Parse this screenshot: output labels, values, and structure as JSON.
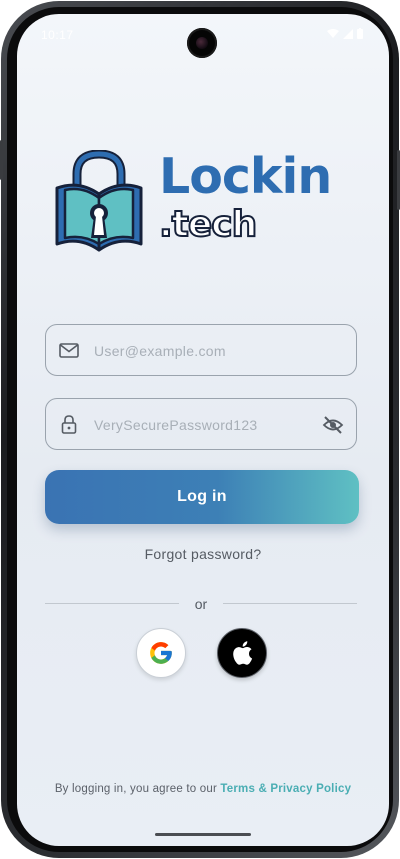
{
  "status_bar": {
    "time": "10:17",
    "left_icons": [
      "notification-icon",
      "sim-icon"
    ],
    "right_icons": [
      "wifi-icon",
      "signal-icon",
      "battery-icon"
    ]
  },
  "logo": {
    "brand": "Lockin",
    "domain": ".tech",
    "colors": {
      "blue": "#2e6db1",
      "teal": "#5fc0c3",
      "outline": "#16213a"
    }
  },
  "form": {
    "email": {
      "value": "",
      "placeholder": "User@example.com",
      "icon": "mail-icon"
    },
    "password": {
      "value": "",
      "placeholder": "VerySecurePassword123",
      "icon": "lock-icon",
      "toggle_icon": "eye-off-icon"
    },
    "login_label": "Log in",
    "forgot_label": "Forgot password?",
    "divider_label": "or"
  },
  "social": {
    "google_icon": "google-icon",
    "apple_icon": "apple-icon"
  },
  "footer": {
    "terms_prefix": "By logging in, you agree to our ",
    "terms_link": "Terms & Privacy Policy"
  },
  "colors": {
    "accent": "#3a73b3",
    "accent_end": "#5fc0c3",
    "link": "#4aaeb3",
    "background": "#eef2f7"
  }
}
